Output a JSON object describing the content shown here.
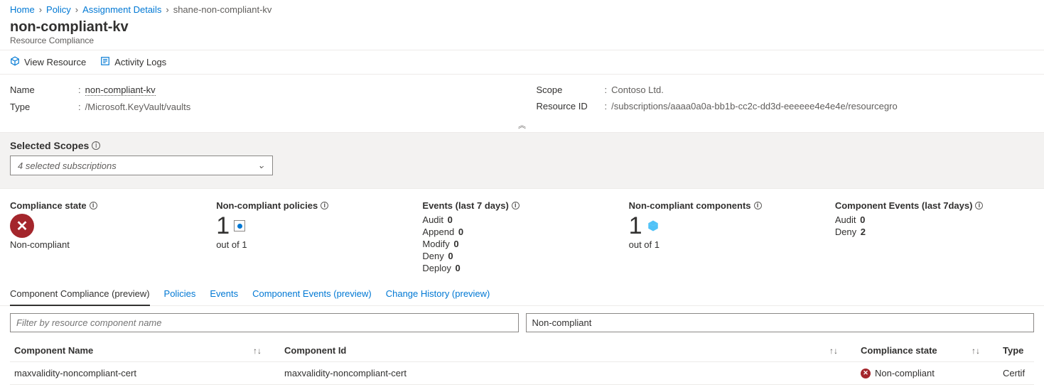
{
  "breadcrumb": [
    {
      "label": "Home",
      "link": true
    },
    {
      "label": "Policy",
      "link": true
    },
    {
      "label": "Assignment Details",
      "link": true
    },
    {
      "label": "shane-non-compliant-kv",
      "link": false
    }
  ],
  "title": "non-compliant-kv",
  "subtitle": "Resource Compliance",
  "toolbar": {
    "view_resource": "View Resource",
    "activity_logs": "Activity Logs"
  },
  "properties": {
    "left": [
      {
        "label": "Name",
        "value": "non-compliant-kv",
        "link": true
      },
      {
        "label": "Type",
        "value": "/Microsoft.KeyVault/vaults",
        "link": false
      }
    ],
    "right": [
      {
        "label": "Scope",
        "value": "Contoso Ltd."
      },
      {
        "label": "Resource ID",
        "value": "/subscriptions/aaaa0a0a-bb1b-cc2c-dd3d-eeeeee4e4e4e/resourcegro"
      }
    ]
  },
  "scopes": {
    "label": "Selected Scopes",
    "value": "4 selected subscriptions"
  },
  "stats": {
    "compliance_state": {
      "label": "Compliance state",
      "value": "Non-compliant"
    },
    "noncompliant_policies": {
      "label": "Non-compliant policies",
      "value": "1",
      "sub": "out of 1"
    },
    "events": {
      "label": "Events (last 7 days)",
      "items": [
        {
          "k": "Audit",
          "v": "0"
        },
        {
          "k": "Append",
          "v": "0"
        },
        {
          "k": "Modify",
          "v": "0"
        },
        {
          "k": "Deny",
          "v": "0"
        },
        {
          "k": "Deploy",
          "v": "0"
        }
      ]
    },
    "noncompliant_components": {
      "label": "Non-compliant components",
      "value": "1",
      "sub": "out of 1"
    },
    "component_events": {
      "label": "Component Events (last 7days)",
      "items": [
        {
          "k": "Audit",
          "v": "0"
        },
        {
          "k": "Deny",
          "v": "2"
        }
      ]
    }
  },
  "tabs": [
    {
      "label": "Component Compliance (preview)",
      "active": true
    },
    {
      "label": "Policies"
    },
    {
      "label": "Events"
    },
    {
      "label": "Component Events (preview)"
    },
    {
      "label": "Change History (preview)"
    }
  ],
  "filters": {
    "name_placeholder": "Filter by resource component name",
    "state_value": "Non-compliant"
  },
  "table": {
    "headers": {
      "name": "Component Name",
      "id": "Component Id",
      "state": "Compliance state",
      "type": "Type"
    },
    "rows": [
      {
        "name": "maxvalidity-noncompliant-cert",
        "id": "maxvalidity-noncompliant-cert",
        "state": "Non-compliant",
        "type": "Certif"
      }
    ]
  }
}
